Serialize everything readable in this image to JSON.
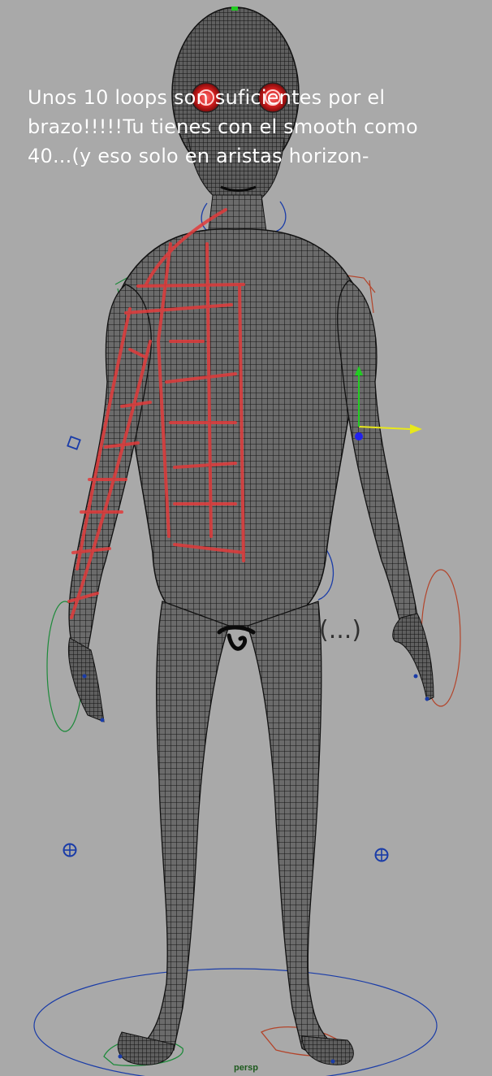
{
  "viewport": {
    "camera": "persp",
    "background_color": "#a9a9a9"
  },
  "annotation": {
    "text": "Unos 10 loops son suficientes por el brazo!!!!!Tu tienes con el smooth como 40...(y eso solo en aristas horizon-",
    "color": "#ffffff"
  },
  "side_note": {
    "text": "(...)"
  },
  "colors": {
    "mesh_wire": "#111111",
    "mesh_fill": "#6e6e6e",
    "paint_overlay": "#e23b3b",
    "control_blue": "#1a3ca8",
    "control_green": "#1d8a3a",
    "control_red": "#b3442a",
    "gizmo_yellow": "#e8e81a",
    "gizmo_green": "#22cc22",
    "gizmo_blue": "#2222ee"
  },
  "icons": {
    "locator_left": "globe-locator-icon",
    "locator_right": "globe-locator-icon",
    "move_gizmo": "move-manipulator-icon",
    "cube_control": "cube-control-icon"
  }
}
